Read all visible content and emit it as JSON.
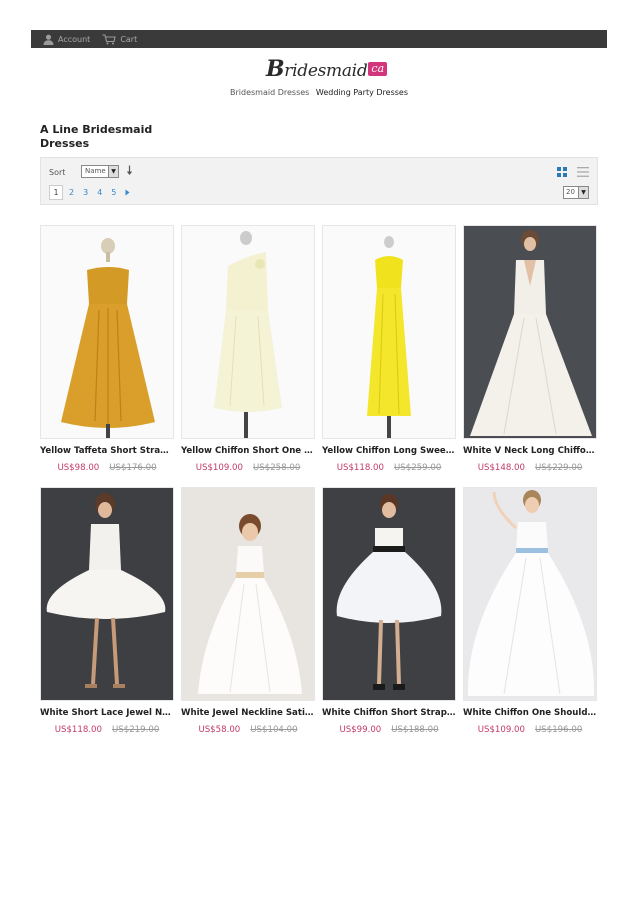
{
  "topbar": {
    "account_label": "Account",
    "cart_label": "Cart",
    "account_icon": "user-icon",
    "cart_icon": "cart-icon"
  },
  "logo": {
    "text_main": "B",
    "text_rest": "ridesmaid",
    "badge": "ca"
  },
  "nav": {
    "link1": "Bridesmaid Dresses",
    "link2": "Wedding Party Dresses"
  },
  "page_title": "A Line Bridesmaid Dresses",
  "toolbar": {
    "sort_label": "Sort",
    "sort_value": "Name",
    "sort_direction_icon": "arrow-down-icon",
    "current_page": "1",
    "pages": [
      "2",
      "3",
      "4",
      "5"
    ],
    "next_icon": "caret-right-icon",
    "per_page": "20",
    "grid_icon": "grid-view-icon",
    "list_icon": "list-view-icon"
  },
  "colors": {
    "price": "#c2396a",
    "link": "#3a87c8",
    "topbar": "#3a3a3a",
    "badge": "#d2357b"
  },
  "products": [
    {
      "name": "Yellow Taffeta Short Strapless A Line Bridesmaid Dress",
      "price": "US$98.00",
      "old_price": "US$176.00"
    },
    {
      "name": "Yellow Chiffon Short One Shoulder Bridesmaid Dress",
      "price": "US$109.00",
      "old_price": "US$258.00"
    },
    {
      "name": "Yellow Chiffon Long Sweetheart Bridesmaid Dress",
      "price": "US$118.00",
      "old_price": "US$259.00"
    },
    {
      "name": "White V Neck Long Chiffon Bridesmaid Dress",
      "price": "US$148.00",
      "old_price": "US$229.00"
    },
    {
      "name": "White Short Lace Jewel Neckline Bridesmaid Dress",
      "price": "US$118.00",
      "old_price": "US$219.00"
    },
    {
      "name": "White Jewel Neckline Satin Flower Girl Dress",
      "price": "US$58.00",
      "old_price": "US$104.00"
    },
    {
      "name": "White Chiffon Short Strapless Bridesmaid Dress",
      "price": "US$99.00",
      "old_price": "US$188.00"
    },
    {
      "name": "White Chiffon One Shoulder Long Bridesmaid Dress",
      "price": "US$109.00",
      "old_price": "US$196.00"
    }
  ]
}
